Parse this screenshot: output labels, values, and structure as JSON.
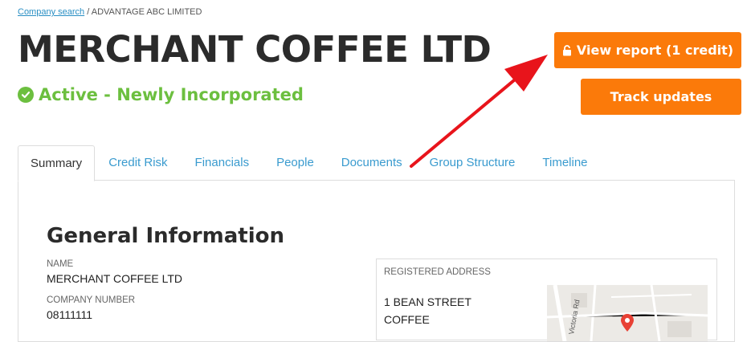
{
  "breadcrumb": {
    "link_label": "Company search",
    "separator": "/",
    "current": "ADVANTAGE ABC LIMITED"
  },
  "company": {
    "name": "MERCHANT COFFEE LTD",
    "status": "Active - Newly Incorporated"
  },
  "actions": {
    "view_report_label": "View report (1 credit)",
    "track_updates_label": "Track updates"
  },
  "tabs": [
    {
      "label": "Summary",
      "active": true
    },
    {
      "label": "Credit Risk"
    },
    {
      "label": "Financials"
    },
    {
      "label": "People"
    },
    {
      "label": "Documents"
    },
    {
      "label": "Group Structure"
    },
    {
      "label": "Timeline"
    }
  ],
  "general_info": {
    "title": "General Information",
    "name_label": "NAME",
    "name_value": "MERCHANT COFFEE LTD",
    "company_number_label": "COMPANY NUMBER",
    "company_number_value": "08111111"
  },
  "registered_address": {
    "label": "REGISTERED ADDRESS",
    "lines": [
      "1 BEAN STREET",
      "COFFEE"
    ],
    "map_road_label": "Victoria Rd"
  },
  "colors": {
    "accent_orange": "#fb7a0a",
    "status_green": "#6cbf3f",
    "link_blue": "#3a9bcf",
    "annotation_red": "#e8141b"
  }
}
